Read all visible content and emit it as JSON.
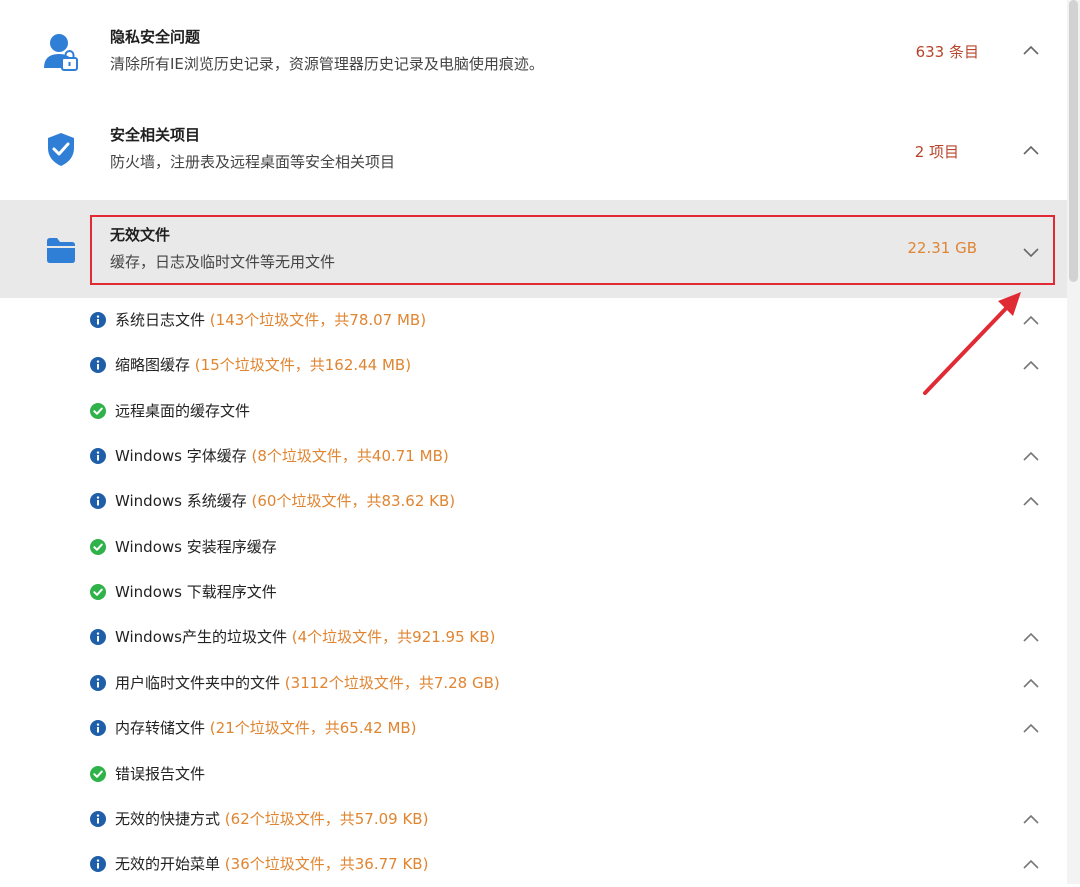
{
  "categories": [
    {
      "title": "隐私安全问题",
      "desc": "清除所有IE浏览历史记录，资源管理器历史记录及电脑使用痕迹。",
      "count": "633 条目",
      "icon": "user-lock-icon"
    },
    {
      "title": "安全相关项目",
      "desc": "防火墙，注册表及远程桌面等安全相关项目",
      "count": "2 项目",
      "icon": "shield-check-icon"
    },
    {
      "title": "无效文件",
      "desc": "缓存，日志及临时文件等无用文件",
      "count": "22.31 GB",
      "icon": "folder-icon"
    }
  ],
  "items": [
    {
      "name": "系统日志文件",
      "detail": "(143个垃圾文件，共78.07 MB)",
      "status": "info"
    },
    {
      "name": "缩略图缓存",
      "detail": "(15个垃圾文件，共162.44 MB)",
      "status": "info"
    },
    {
      "name": "远程桌面的缓存文件",
      "detail": "",
      "status": "ok"
    },
    {
      "name": "Windows 字体缓存",
      "detail": "(8个垃圾文件，共40.71 MB)",
      "status": "info"
    },
    {
      "name": "Windows 系统缓存",
      "detail": "(60个垃圾文件，共83.62 KB)",
      "status": "info"
    },
    {
      "name": "Windows 安装程序缓存",
      "detail": "",
      "status": "ok"
    },
    {
      "name": "Windows 下载程序文件",
      "detail": "",
      "status": "ok"
    },
    {
      "name": "Windows产生的垃圾文件",
      "detail": "(4个垃圾文件，共921.95 KB)",
      "status": "info"
    },
    {
      "name": "用户临时文件夹中的文件",
      "detail": "(3112个垃圾文件，共7.28 GB)",
      "status": "info"
    },
    {
      "name": "内存转储文件",
      "detail": "(21个垃圾文件，共65.42 MB)",
      "status": "info"
    },
    {
      "name": "错误报告文件",
      "detail": "",
      "status": "ok"
    },
    {
      "name": "无效的快捷方式",
      "detail": "(62个垃圾文件，共57.09 KB)",
      "status": "info"
    },
    {
      "name": "无效的开始菜单",
      "detail": "(36个垃圾文件，共36.77 KB)",
      "status": "info"
    }
  ],
  "colors": {
    "accent": "#2f7fd6",
    "ok": "#2fb24a",
    "info": "#1f5ea8",
    "count_red": "#b8442b",
    "count_orange": "#e08531",
    "highlight": "#e02b34"
  }
}
